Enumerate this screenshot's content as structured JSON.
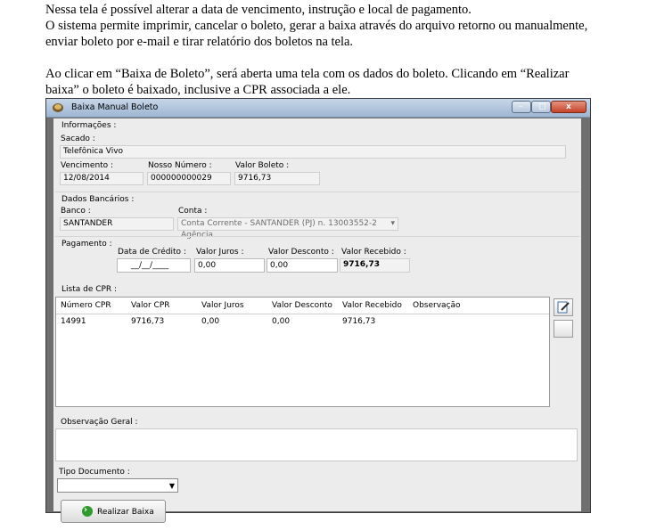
{
  "doc": {
    "line1": "Nessa tela é possível alterar a data de vencimento, instrução e local de pagamento.",
    "line2": "O sistema permite imprimir, cancelar o boleto, gerar a baixa através do arquivo retorno ou manualmente,",
    "line3": "enviar boleto por e-mail e tirar relatório dos boletos na tela.",
    "line4": "Ao clicar em “Baixa de Boleto”, será aberta uma tela com os dados do boleto. Clicando em “Realizar",
    "line5": "baixa” o boleto é baixado, inclusive a CPR associada a ele."
  },
  "window": {
    "title": "Baixa Manual Boleto",
    "min_glyph": "–",
    "max_glyph": "□",
    "close_glyph": "x"
  },
  "info": {
    "section": "Informações :",
    "sacado_label": "Sacado :",
    "sacado_value": "Telefônica Vivo",
    "vencimento_label": "Vencimento :",
    "vencimento_value": "12/08/2014",
    "nosso_numero_label": "Nosso Número :",
    "nosso_numero_value": "000000000029",
    "valor_boleto_label": "Valor Boleto :",
    "valor_boleto_value": "9716,73"
  },
  "bank": {
    "section": "Dados Bancários :",
    "banco_label": "Banco :",
    "banco_value": "SANTANDER",
    "conta_label": "Conta :",
    "conta_value": "Conta Corrente - SANTANDER (PJ) n. 13003552-2  Agência"
  },
  "payment": {
    "section": "Pagamento :",
    "data_credito_label": "Data de Crédito :",
    "data_credito_value": "__/__/____",
    "juros_label": "Valor Juros :",
    "juros_value": "0,00",
    "desconto_label": "Valor Desconto :",
    "desconto_value": "0,00",
    "recebido_label": "Valor Recebido :",
    "recebido_value": "9716,73"
  },
  "cpr": {
    "section": "Lista de CPR :",
    "columns": [
      "Número CPR",
      "Valor CPR",
      "Valor Juros",
      "Valor Desconto",
      "Valor Recebido",
      "Observação"
    ],
    "rows": [
      [
        "14991",
        "9716,73",
        "0,00",
        "0,00",
        "9716,73",
        ""
      ]
    ]
  },
  "obs": {
    "label": "Observação Geral :"
  },
  "tipo": {
    "label": "Tipo Documento :",
    "value": ""
  },
  "action": {
    "label": "Realizar Baixa"
  },
  "colors": {
    "titlebar": "#b4c8e0",
    "window_bg": "#ececec",
    "close": "#c5432a",
    "ok_icon": "#2f9b2f"
  }
}
